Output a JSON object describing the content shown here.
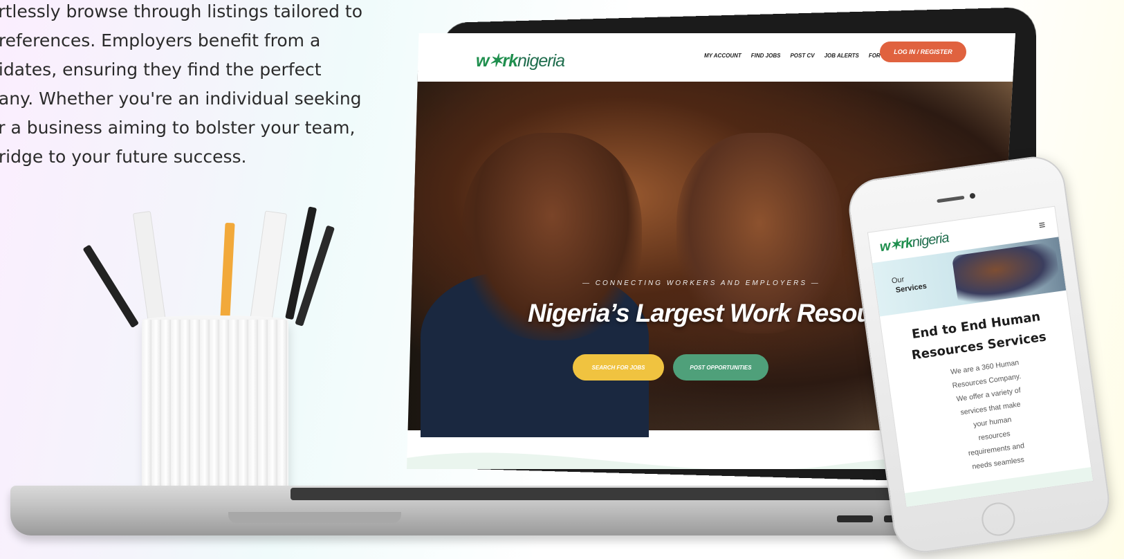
{
  "intro": {
    "lines": [
      "ortlessly browse through listings tailored to",
      "preferences. Employers benefit from a",
      "didates, ensuring they find the perfect",
      "pany. Whether you're an individual seeking",
      "or a business aiming to bolster your team,",
      "bridge to your future success."
    ]
  },
  "laptop_site": {
    "logo_w": "w✶rk",
    "logo_n": "nigeria",
    "nav": [
      "MY ACCOUNT",
      "FIND JOBS",
      "POST CV",
      "JOB ALERTS",
      "FOR EMPLOYERS"
    ],
    "login_label": "LOG IN / REGISTER",
    "tagline": "— CONNECTING WORKERS AND EMPLOYERS —",
    "headline": "Nigeria’s Largest Work Resource",
    "search_jobs_label": "SEARCH FOR JOBS",
    "post_opportunities_label": "POST OPPORTUNITIES"
  },
  "phone_site": {
    "logo_w": "w✶rk",
    "logo_n": "nigeria",
    "menu_icon": "≡",
    "banner_small": "Our",
    "banner_big": "Services",
    "title_lines": [
      "End to End Human",
      "Resources Services"
    ],
    "body_lines": [
      "We are a 360 Human",
      "Resources Company.",
      "We offer a variety of",
      "services that make",
      "your human",
      "resources",
      "requirements and",
      "needs seamless"
    ]
  },
  "colors": {
    "brand_green": "#1f8f4e",
    "login_orange": "#e0623f",
    "search_yellow": "#f0c340",
    "post_green": "#4fa07a"
  }
}
